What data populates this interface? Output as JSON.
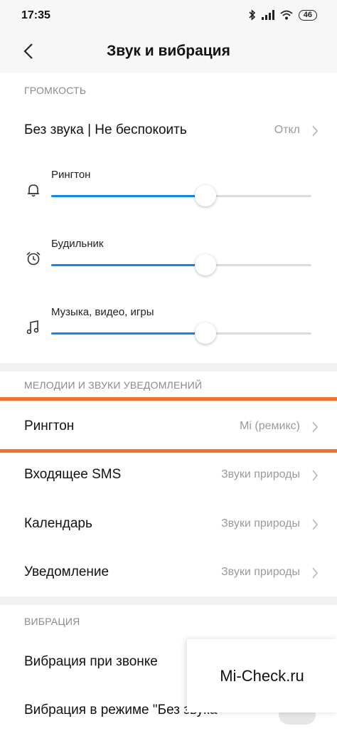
{
  "status": {
    "time": "17:35",
    "battery": "46"
  },
  "header": {
    "title": "Звук и вибрация"
  },
  "volume": {
    "section_title": "ГРОМКОСТЬ",
    "dnd_label": "Без звука | Не беспокоить",
    "dnd_value": "Откл",
    "sliders": [
      {
        "label": "Рингтон",
        "icon": "bell-icon",
        "level": 0.59
      },
      {
        "label": "Будильник",
        "icon": "alarm-clock-icon",
        "level": 0.59
      },
      {
        "label": "Музыка, видео, игры",
        "icon": "music-note-icon",
        "level": 0.59
      }
    ]
  },
  "sounds": {
    "section_title": "МЕЛОДИИ И ЗВУКИ УВЕДОМЛЕНИЙ",
    "items": [
      {
        "label": "Рингтон",
        "value": "Mi (ремикс)"
      },
      {
        "label": "Входящее SMS",
        "value": "Звуки природы"
      },
      {
        "label": "Календарь",
        "value": "Звуки природы"
      },
      {
        "label": "Уведомление",
        "value": "Звуки природы"
      }
    ]
  },
  "vibration": {
    "section_title": "ВИБРАЦИЯ",
    "items": [
      {
        "label": "Вибрация при звонке"
      },
      {
        "label": "Вибрация в режиме \"Без звука"
      }
    ]
  },
  "watermark": "Mi-Check.ru",
  "colors": {
    "accent": "#0d84ff",
    "highlight": "#f5712a"
  }
}
